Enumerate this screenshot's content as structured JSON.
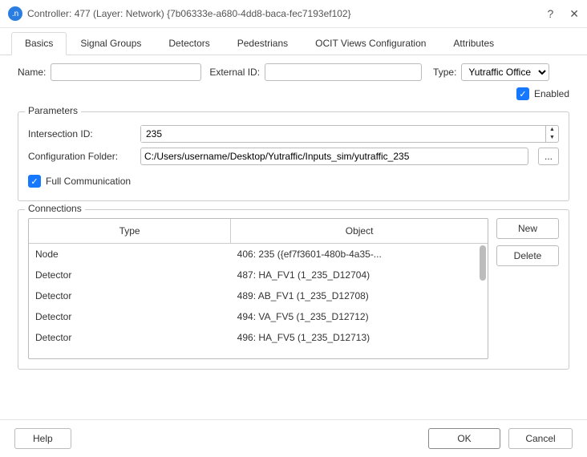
{
  "title": "Controller: 477 (Layer: Network) {7b06333e-a680-4dd8-baca-fec7193ef102}",
  "titlebar_icon": ".n",
  "titlebar_help": "?",
  "titlebar_close": "✕",
  "tabs": {
    "basics": "Basics",
    "signal_groups": "Signal Groups",
    "detectors": "Detectors",
    "pedestrians": "Pedestrians",
    "ocit": "OCIT Views Configuration",
    "attributes": "Attributes"
  },
  "labels": {
    "name": "Name:",
    "external_id": "External ID:",
    "type": "Type:",
    "enabled": "Enabled",
    "parameters_legend": "Parameters",
    "intersection_id": "Intersection ID:",
    "config_folder": "Configuration Folder:",
    "full_comm": "Full Communication",
    "connections_legend": "Connections",
    "col_type": "Type",
    "col_object": "Object",
    "new_btn": "New",
    "delete_btn": "Delete",
    "help_btn": "Help",
    "ok_btn": "OK",
    "cancel_btn": "Cancel",
    "browse": "..."
  },
  "values": {
    "name": "",
    "external_id": "",
    "type_selected": "Yutraffic Office",
    "enabled_checked": true,
    "intersection_id": "235",
    "config_folder": "C:/Users/username/Desktop/Yutraffic/Inputs_sim/yutraffic_235",
    "full_comm_checked": true
  },
  "connections": [
    {
      "type": "Node",
      "object": "406: 235 ({ef7f3601-480b-4a35-..."
    },
    {
      "type": "Detector",
      "object": "487: HA_FV1 (1_235_D12704)"
    },
    {
      "type": "Detector",
      "object": "489: AB_FV1 (1_235_D12708)"
    },
    {
      "type": "Detector",
      "object": "494: VA_FV5 (1_235_D12712)"
    },
    {
      "type": "Detector",
      "object": "496: HA_FV5 (1_235_D12713)"
    }
  ]
}
